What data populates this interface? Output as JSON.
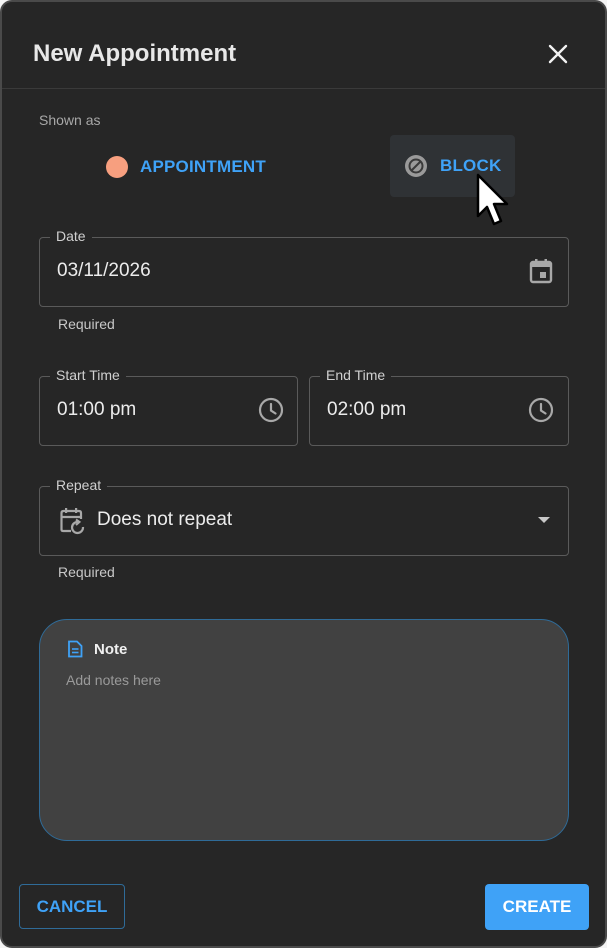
{
  "dialog": {
    "title": "New Appointment"
  },
  "shown_as": {
    "label": "Shown as",
    "options": [
      {
        "label": "APPOINTMENT",
        "color": "#f79f7f"
      },
      {
        "label": "BLOCK",
        "selected": true
      }
    ]
  },
  "date_field": {
    "label": "Date",
    "value": "03/11/2026",
    "helper": "Required",
    "icon": "calendar-icon"
  },
  "start_time": {
    "label": "Start Time",
    "value": "01:00 pm",
    "icon": "clock-icon"
  },
  "end_time": {
    "label": "End Time",
    "value": "02:00 pm",
    "icon": "clock-icon"
  },
  "repeat": {
    "label": "Repeat",
    "value": "Does not repeat",
    "helper": "Required",
    "icon": "calendar-repeat-icon"
  },
  "note": {
    "label": "Note",
    "placeholder": "Add notes here"
  },
  "actions": {
    "cancel": "CANCEL",
    "create": "CREATE"
  },
  "colors": {
    "accent": "#3fa2f7",
    "background": "#262626",
    "appointment_dot": "#f79f7f"
  }
}
